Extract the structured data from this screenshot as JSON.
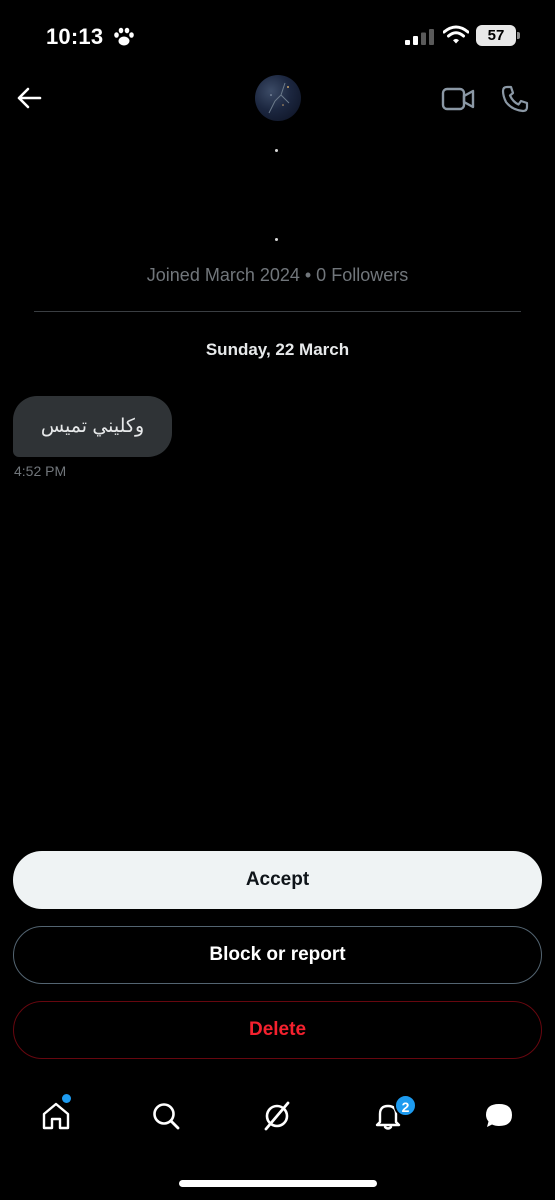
{
  "status_bar": {
    "time": "10:13",
    "battery": "57",
    "icons": [
      "paw-icon",
      "signal-icon",
      "wifi-icon",
      "battery-icon"
    ]
  },
  "header": {
    "icons": [
      "arrow-left-icon",
      "video-camera-icon",
      "phone-icon"
    ]
  },
  "profile": {
    "meta": "Joined March 2024 • 0 Followers"
  },
  "conversation": {
    "date": "Sunday, 22 March",
    "messages": [
      {
        "text": "وكليني تميس",
        "time": "4:52 PM"
      }
    ]
  },
  "actions": {
    "accept": "Accept",
    "block": "Block or report",
    "delete": "Delete"
  },
  "nav": {
    "items": [
      "home-icon",
      "search-icon",
      "grok-icon",
      "bell-icon",
      "messages-icon"
    ],
    "notifications_badge": "2"
  },
  "colors": {
    "background": "#000000",
    "accent": "#1d9bf0",
    "danger": "#f4212e",
    "bubble": "#2f3336",
    "muted": "#71767b"
  }
}
